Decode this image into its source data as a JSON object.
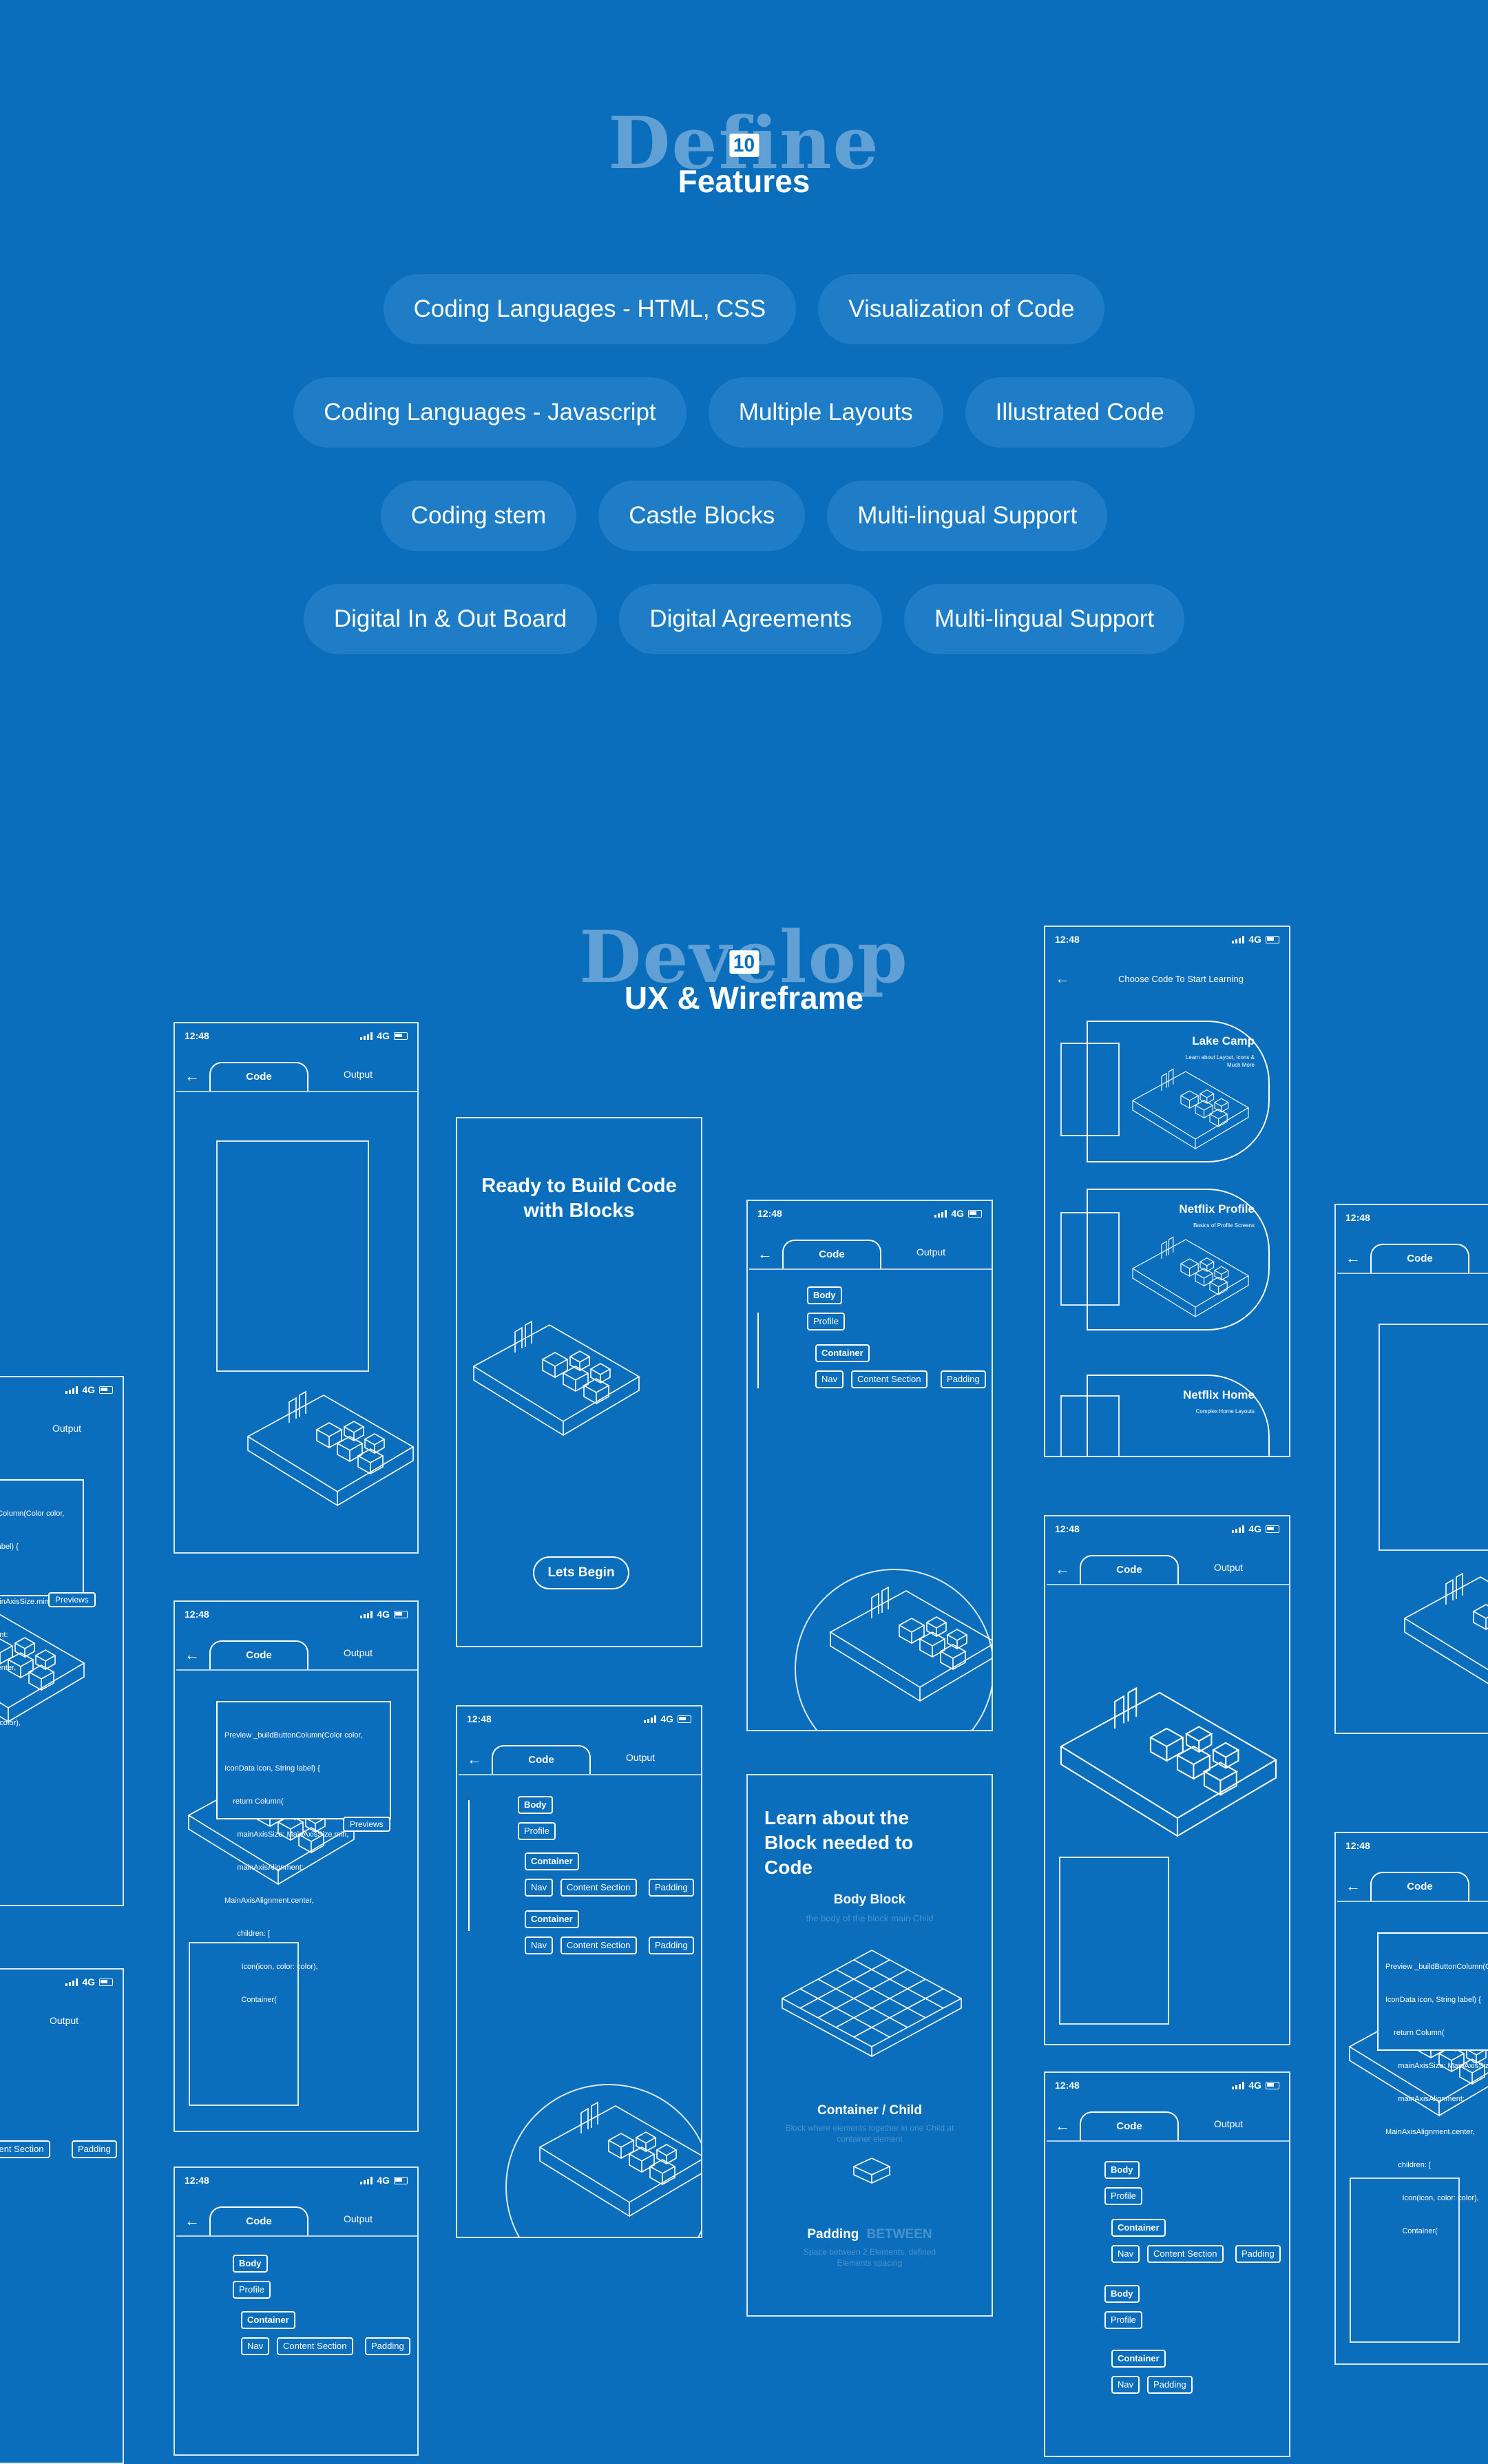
{
  "define": {
    "word": "Define",
    "number": "10",
    "subtitle": "Features"
  },
  "features": [
    [
      "Coding Languages  - HTML, CSS",
      "Visualization of Code"
    ],
    [
      "Coding Languages  - Javascript",
      "Multiple Layouts",
      "Illustrated Code"
    ],
    [
      "Coding stem",
      "Castle Blocks",
      "Multi-lingual Support"
    ],
    [
      "Digital In & Out Board",
      "Digital Agreements",
      "Multi-lingual Support"
    ]
  ],
  "develop": {
    "word": "Develop",
    "number": "10",
    "subtitle": "UX & Wireframe"
  },
  "phone": {
    "time": "12:48",
    "network": "4G",
    "tab_code": "Code",
    "tab_output": "Output",
    "back_icon": "arrow-left-icon"
  },
  "chips": {
    "body": "Body",
    "profile": "Profile",
    "container": "Container",
    "nav": "Nav",
    "content_section": "Content Section",
    "padding": "Padding",
    "previews": "Previews"
  },
  "code_snippet": {
    "lines": [
      "Preview _buildButtonColumn(Color color,",
      "IconData icon, String label) {",
      "    return Column(",
      "      mainAxisSize: MainAxisSize.min,",
      "      mainAxisAlignment:",
      "MainAxisAlignment.center,",
      "      children: [",
      "        Icon(icon, color: color),",
      "        Container("
    ],
    "left_lines": [
      "onColumn(Color color,",
      "g label) {",
      "",
      "MainAxisSize.min,",
      "ment:",
      "t.center,",
      "",
      "on color),"
    ]
  },
  "welcome_card": {
    "title": "Ready to Build Code with Blocks",
    "button": "Lets Begin"
  },
  "learn_card": {
    "title": "Learn about the Block needed to Code",
    "body_block": "Body Block",
    "body_desc": "the body of the block main Child",
    "container_label": "Container / Child",
    "container_desc": "Block where elements together in one Child at container element",
    "padding_label": "Padding",
    "padding_highlight": "BETWEEN",
    "padding_desc": "Space between 2 Elements, defined Elements spacing"
  },
  "choose_screen": {
    "heading": "Choose Code To Start Learning",
    "items": [
      {
        "title": "Lake Camp",
        "desc": "Learn about Layout, Icons & Much More"
      },
      {
        "title": "Netflix Profile",
        "desc": "Basics of Profile Screens"
      },
      {
        "title": "Netflix Home",
        "desc": "Complex Home Layouts"
      }
    ]
  },
  "colors": {
    "background": "#0a6ebd",
    "pill": "#1f7dc7",
    "line": "#ffffff"
  }
}
